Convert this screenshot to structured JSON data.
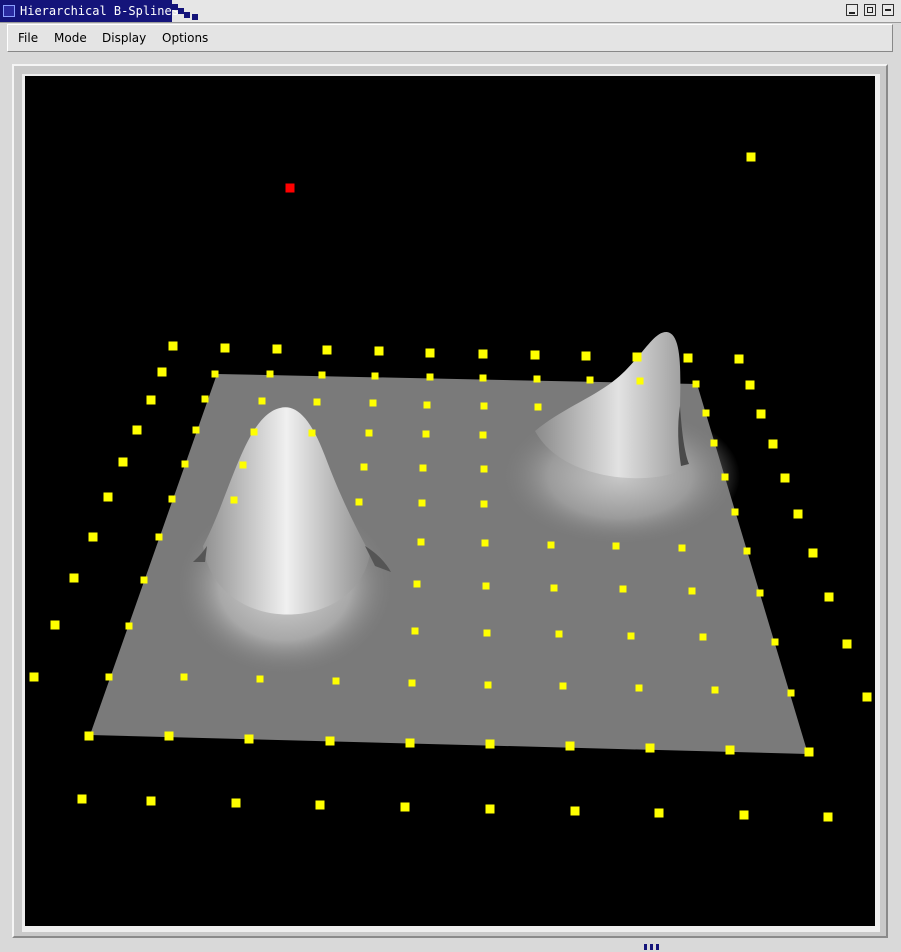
{
  "window": {
    "title": "Hierarchical B-Splines",
    "buttons": [
      "minimize",
      "maximize",
      "close"
    ]
  },
  "menu": {
    "items": [
      "File",
      "Mode",
      "Display",
      "Options"
    ]
  },
  "viewport": {
    "background": "#000000",
    "surface_color": "#7a7a7a",
    "control_point_color": "#ffff00",
    "selected_point_color": "#ff0000"
  }
}
